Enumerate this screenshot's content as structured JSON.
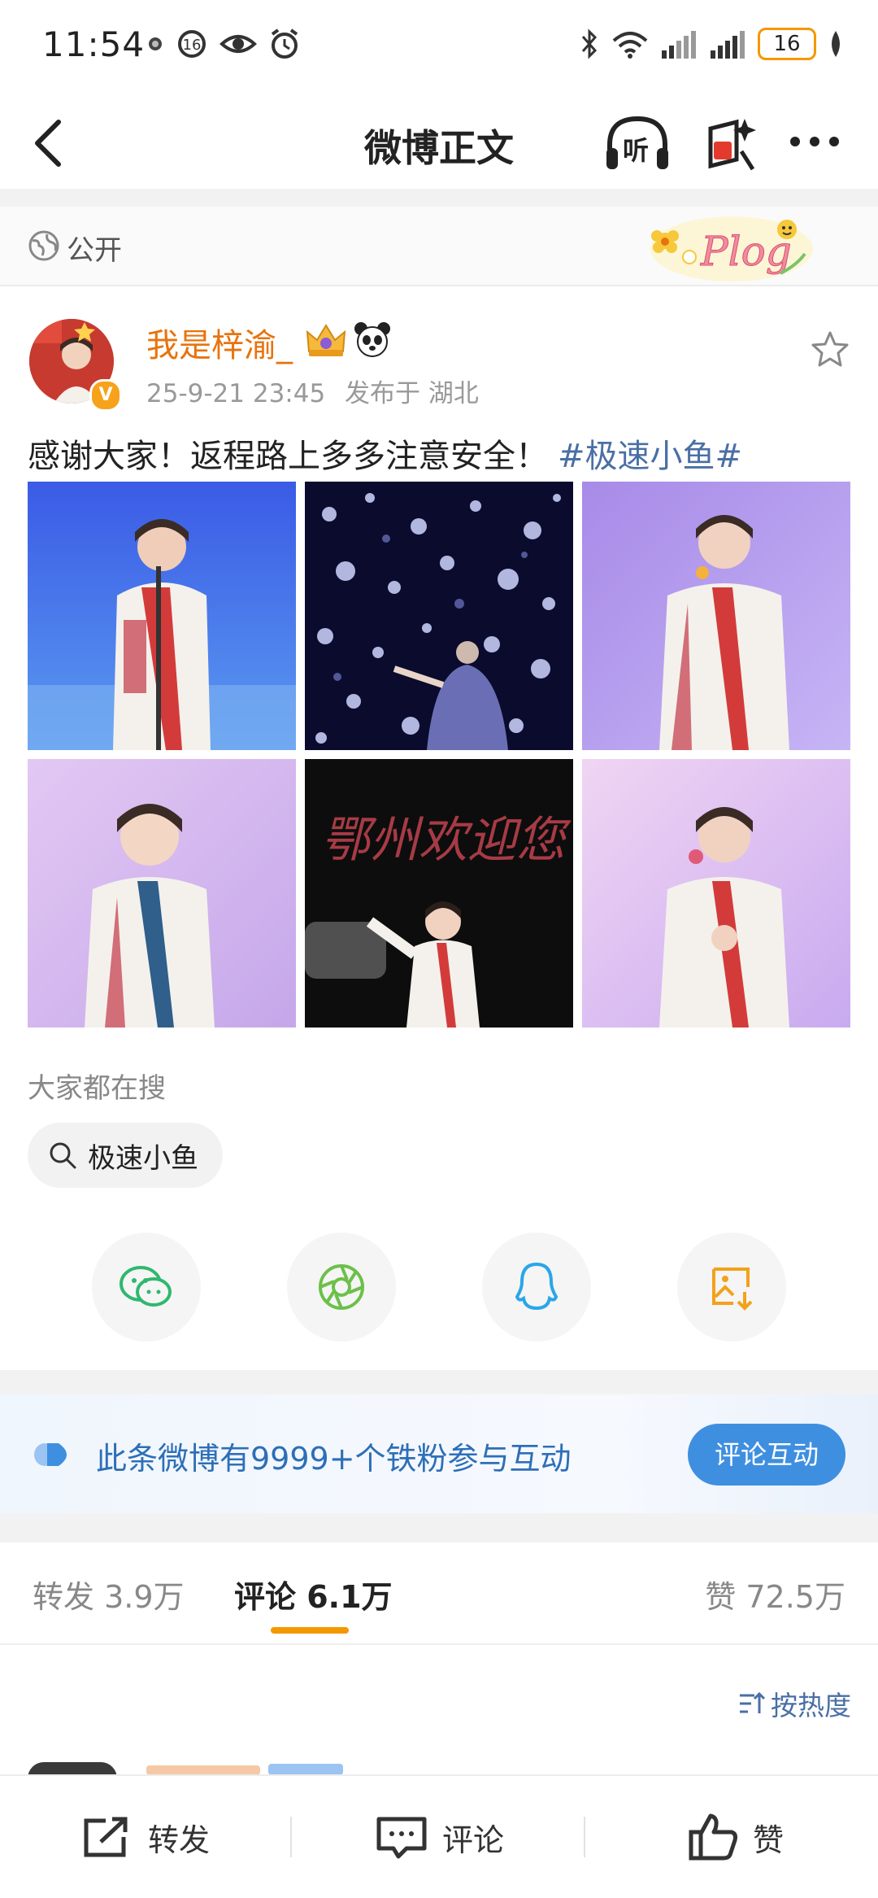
{
  "status_bar": {
    "time": "11:54",
    "battery": "16"
  },
  "nav": {
    "title": "微博正文",
    "listen_label": "听"
  },
  "visibility": {
    "label": "公开",
    "decor_text": "Plog"
  },
  "author": {
    "name": "我是梓渝_",
    "timestamp": "25-9-21 23:45",
    "location": "发布于 湖北"
  },
  "post": {
    "text": "感谢大家！返程路上多多注意安全！",
    "hashtag": "#极速小鱼#",
    "images": [
      {
        "desc": "singer-on-stage-blue"
      },
      {
        "desc": "stage-lights-bokeh"
      },
      {
        "desc": "singer-purple-stage"
      },
      {
        "desc": "singer-smiling-purple"
      },
      {
        "desc": "drone-show-welcome",
        "overlay_text": "鄂州欢迎您"
      },
      {
        "desc": "singer-pink-stage"
      }
    ]
  },
  "search": {
    "section_label": "大家都在搜",
    "chip_label": "极速小鱼"
  },
  "share": {
    "items": [
      "wechat-icon",
      "moments-icon",
      "qq-icon",
      "save-image-icon"
    ]
  },
  "fan_banner": {
    "text": "此条微博有9999+个铁粉参与互动",
    "button": "评论互动"
  },
  "tabs": {
    "repost": "转发 3.9万",
    "comment": "评论 6.1万",
    "like": "赞 72.5万"
  },
  "sort": {
    "label": "按热度"
  },
  "bottom_bar": {
    "repost": "转发",
    "comment": "评论",
    "like": "赞"
  },
  "colors": {
    "accent_orange": "#e8730d",
    "link_blue": "#4a6fa5",
    "tab_underline": "#f39800",
    "button_blue": "#3f8fe0"
  }
}
